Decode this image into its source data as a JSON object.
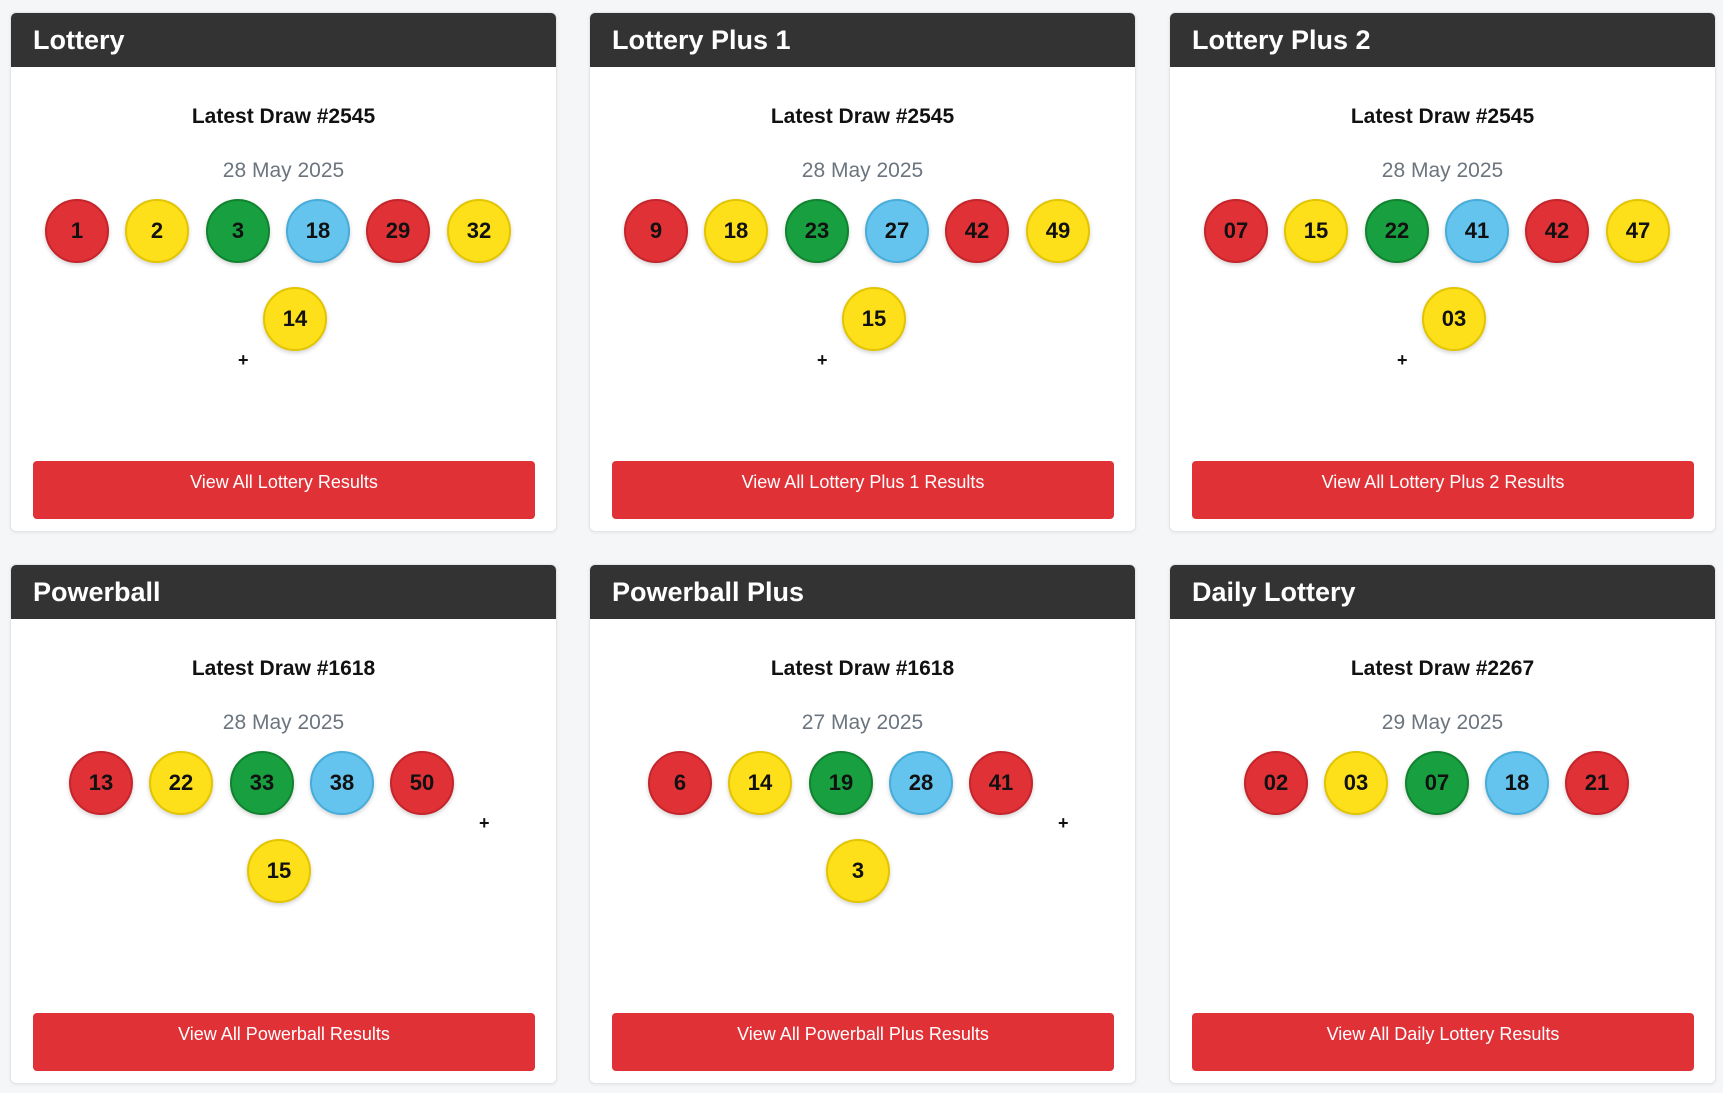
{
  "cards": [
    {
      "title": "Lottery",
      "draw": "Latest Draw #2545",
      "date": "28 May 2025",
      "balls": [
        "1",
        "2",
        "3",
        "18",
        "29",
        "32"
      ],
      "bonus": "14",
      "plus": "+",
      "button": "View All Lottery Results"
    },
    {
      "title": "Lottery Plus 1",
      "draw": "Latest Draw #2545",
      "date": "28 May 2025",
      "balls": [
        "9",
        "18",
        "23",
        "27",
        "42",
        "49"
      ],
      "bonus": "15",
      "plus": "+",
      "button": "View All Lottery Plus 1 Results"
    },
    {
      "title": "Lottery Plus 2",
      "draw": "Latest Draw #2545",
      "date": "28 May 2025",
      "balls": [
        "07",
        "15",
        "22",
        "41",
        "42",
        "47"
      ],
      "bonus": "03",
      "plus": "+",
      "button": "View All Lottery Plus 2 Results"
    },
    {
      "title": "Powerball",
      "draw": "Latest Draw #1618",
      "date": "28 May 2025",
      "balls": [
        "13",
        "22",
        "33",
        "38",
        "50"
      ],
      "bonus": "15",
      "plus": "+",
      "button": "View All Powerball Results"
    },
    {
      "title": "Powerball Plus",
      "draw": "Latest Draw #1618",
      "date": "27 May 2025",
      "balls": [
        "6",
        "14",
        "19",
        "28",
        "41"
      ],
      "bonus": "3",
      "plus": "+",
      "button": "View All Powerball Plus Results"
    },
    {
      "title": "Daily Lottery",
      "draw": "Latest Draw #2267",
      "date": "29 May 2025",
      "balls": [
        "02",
        "03",
        "07",
        "18",
        "21"
      ],
      "button": "View All Daily Lottery Results"
    }
  ],
  "colors": {
    "header_bg": "#333333",
    "button_bg": "#e03137",
    "ball_red": "#e03137",
    "ball_yellow": "#fde01a",
    "ball_green": "#18a040",
    "ball_blue": "#64c4ee"
  }
}
